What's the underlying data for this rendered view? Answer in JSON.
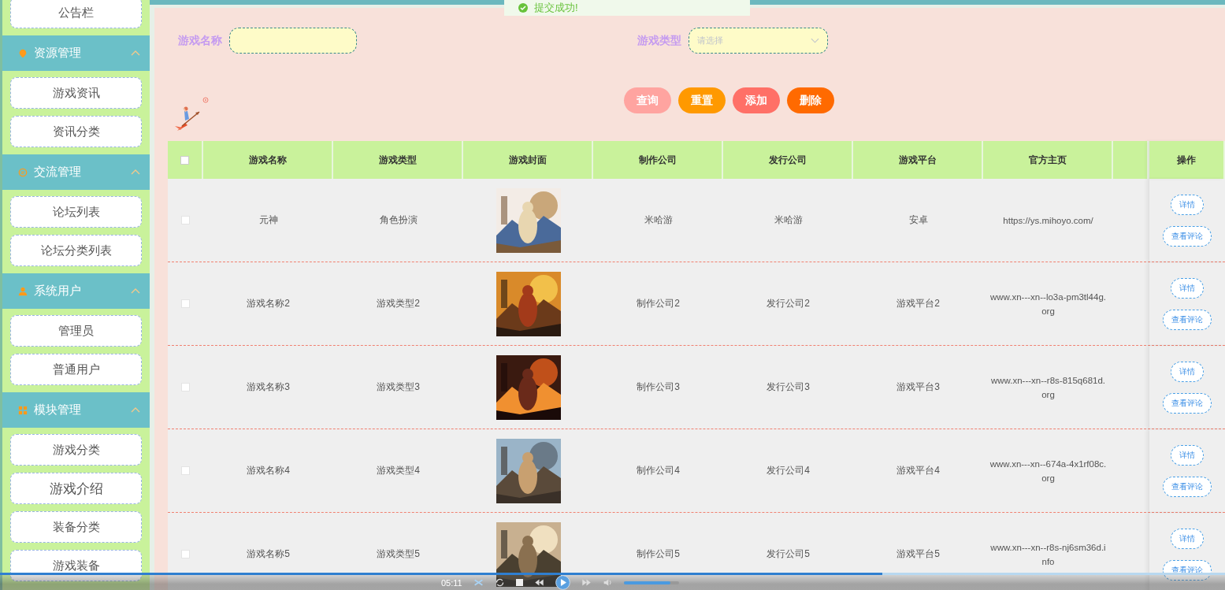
{
  "toast": {
    "text": "提交成功!"
  },
  "sidebar": {
    "top_item": {
      "label": "公告栏"
    },
    "groups": [
      {
        "title": "资源管理",
        "expanded": true,
        "items": [
          "游戏资讯",
          "资讯分类"
        ]
      },
      {
        "title": "交流管理",
        "expanded": true,
        "items": [
          "论坛列表",
          "论坛分类列表"
        ]
      },
      {
        "title": "系统用户",
        "expanded": true,
        "items": [
          "管理员",
          "普通用户"
        ]
      },
      {
        "title": "模块管理",
        "expanded": true,
        "items": [
          "游戏分类",
          "游戏介绍",
          "装备分类",
          "游戏装备"
        ]
      }
    ]
  },
  "search": {
    "fields": [
      {
        "label": "游戏名称",
        "kind": "input"
      },
      {
        "label": "游戏类型",
        "kind": "select",
        "placeholder": "请选择"
      }
    ]
  },
  "buttons": [
    {
      "label": "查询",
      "color": "#ffa4a0"
    },
    {
      "label": "重置",
      "color": "#ff9900"
    },
    {
      "label": "添加",
      "color": "#ff7067"
    },
    {
      "label": "删除",
      "color": "#ff6a00"
    }
  ],
  "table": {
    "header_checkbox": {
      "checked": false
    },
    "columns": [
      "游戏名称",
      "游戏类型",
      "游戏封面",
      "制作公司",
      "发行公司",
      "游戏平台",
      "官方主页",
      "操作"
    ],
    "rows": [
      {
        "checked": false,
        "name": "元神",
        "type": "角色扮演",
        "cover": {
          "kind": "picture"
        },
        "maker": "米哈游",
        "publisher": "米哈游",
        "platform": "安卓",
        "homepage": [
          "https://ys.mihoyo.com/"
        ],
        "actions": [
          "详情",
          "查看评论"
        ]
      },
      {
        "checked": false,
        "name": "游戏名称2",
        "type": "游戏类型2",
        "cover": {
          "kind": "picture"
        },
        "maker": "制作公司2",
        "publisher": "发行公司2",
        "platform": "游戏平台2",
        "homepage": [
          "www.xn---xn--lo3a-pm3tl44g.",
          "org"
        ],
        "actions": [
          "详情",
          "查看评论"
        ]
      },
      {
        "checked": false,
        "name": "游戏名称3",
        "type": "游戏类型3",
        "cover": {
          "kind": "picture"
        },
        "maker": "制作公司3",
        "publisher": "发行公司3",
        "platform": "游戏平台3",
        "homepage": [
          "www.xn---xn--r8s-815q681d.",
          "org"
        ],
        "actions": [
          "详情",
          "查看评论"
        ]
      },
      {
        "checked": false,
        "name": "游戏名称4",
        "type": "游戏类型4",
        "cover": {
          "kind": "picture"
        },
        "maker": "制作公司4",
        "publisher": "发行公司4",
        "platform": "游戏平台4",
        "homepage": [
          "www.xn---xn--674a-4x1rf08c.",
          "org"
        ],
        "actions": [
          "详情",
          "查看评论"
        ]
      },
      {
        "checked": false,
        "name": "游戏名称5",
        "type": "游戏类型5",
        "cover": {
          "kind": "picture"
        },
        "maker": "制作公司5",
        "publisher": "发行公司5",
        "platform": "游戏平台5",
        "homepage": [
          "www.xn---xn--r8s-nj6sm36d.i",
          "nfo"
        ],
        "actions": [
          "详情",
          "查看评论"
        ]
      }
    ]
  },
  "player": {
    "time": "05:11",
    "progress": {
      "level": 0.72
    },
    "volume": {
      "level": 0.85
    }
  }
}
